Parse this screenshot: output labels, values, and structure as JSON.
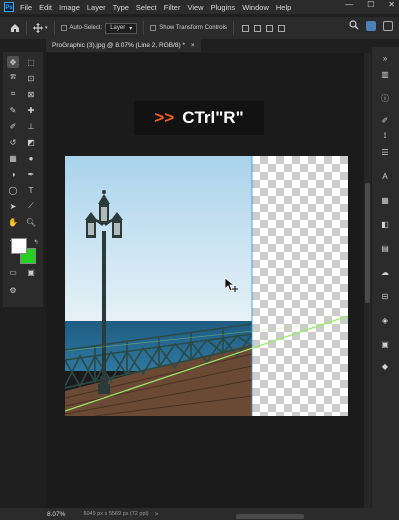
{
  "menubar": {
    "logo": "Ps",
    "items": [
      "File",
      "Edit",
      "Image",
      "Layer",
      "Type",
      "Select",
      "Filter",
      "View",
      "Plugins",
      "Window",
      "Help"
    ],
    "window_buttons": [
      "—",
      "☐",
      "✕"
    ]
  },
  "options_bar": {
    "auto_select_label": "Auto-Select:",
    "auto_select_value": "Layer",
    "show_transform_label": "Show Transform Controls"
  },
  "document_tab": {
    "title": "ProGraphic (3).jpg @ 8.07% (Line 2, RGB/8) *",
    "close": "×"
  },
  "overlay_caption": {
    "arrow": ">>",
    "keys": "CTrl\"R\""
  },
  "status_bar": {
    "zoom": "8.07%",
    "doc_info": "6049 px x 5569 px (72 ppi)",
    "nav_arrow": ">"
  },
  "colors": {
    "foreground": "#ffffff",
    "background": "#22d21e",
    "guide_line": "#9be86c",
    "caption_arrow": "#f15a24"
  }
}
